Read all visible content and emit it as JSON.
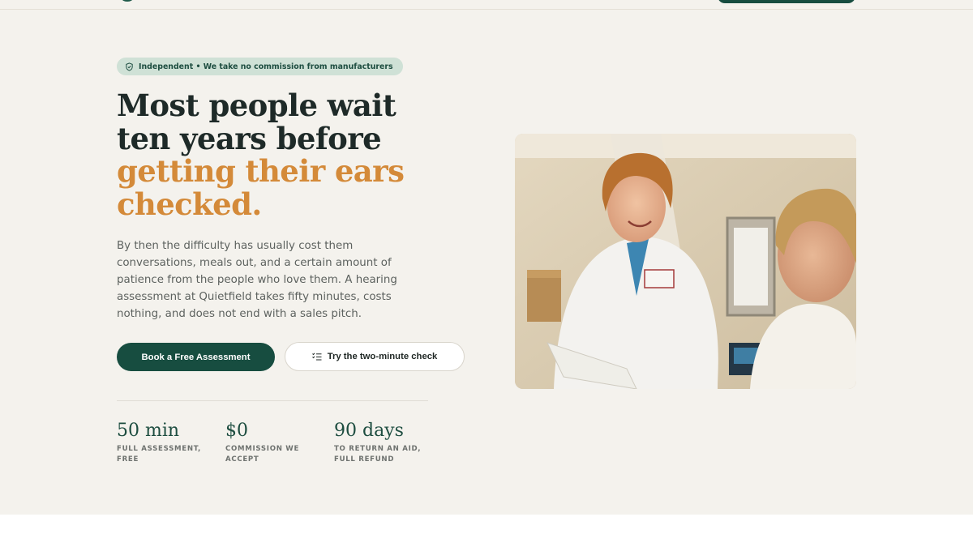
{
  "badge": {
    "icon": "shield-check-icon",
    "text": "Independent • We take no commission from manufacturers"
  },
  "headline": {
    "line1": "Most people wait",
    "line2": "ten years before",
    "accent1": "getting their ears",
    "accent2": "checked."
  },
  "lede": "By then the difficulty has usually cost them conversations, meals out, and a certain amount of patience from the people who love them. A hearing assessment at Quietfield takes fifty minutes, costs nothing, and does not end with a sales pitch.",
  "buttons": {
    "primary": "Book a Free Assessment",
    "secondary": "Try the two-minute check",
    "secondary_icon": "checklist-icon"
  },
  "stats": [
    {
      "value": "50 min",
      "label": "Full assessment, free"
    },
    {
      "value": "$0",
      "label": "Commission we accept"
    },
    {
      "value": "90 days",
      "label": "To return an aid, full refund"
    }
  ],
  "colors": {
    "brand": "#174d40",
    "accent": "#d48a39",
    "background": "#f4f2ed",
    "badge_bg": "#cfe1d6"
  }
}
